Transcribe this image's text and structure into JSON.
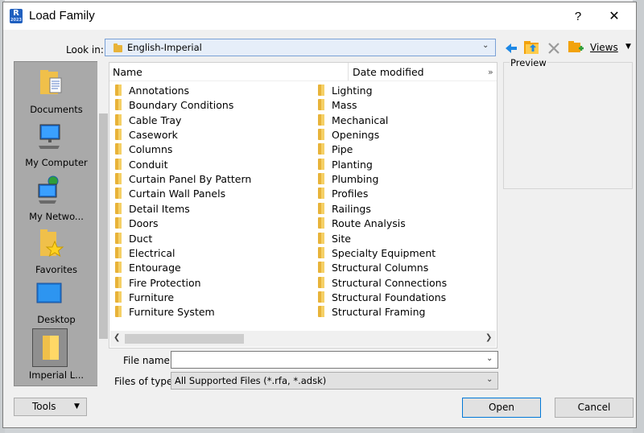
{
  "window": {
    "title": "Load Family",
    "app_icon": "R",
    "app_icon_sub": "2023",
    "help": "?",
    "close": "✕"
  },
  "lookin": {
    "label": "Look in:",
    "value": "English-Imperial"
  },
  "toolbar": {
    "views_label": "Views"
  },
  "places": [
    {
      "label": "Documents"
    },
    {
      "label": "My Computer"
    },
    {
      "label": "My Netwo..."
    },
    {
      "label": "Favorites"
    },
    {
      "label": "Desktop"
    },
    {
      "label": "Imperial L..."
    }
  ],
  "list": {
    "col_name": "Name",
    "col_date": "Date modified",
    "col_more": "»",
    "left_items": [
      "Annotations",
      "Boundary Conditions",
      "Cable Tray",
      "Casework",
      "Columns",
      "Conduit",
      "Curtain Panel By Pattern",
      "Curtain Wall Panels",
      "Detail Items",
      "Doors",
      "Duct",
      "Electrical",
      "Entourage",
      "Fire Protection",
      "Furniture",
      "Furniture System"
    ],
    "right_items": [
      "Lighting",
      "Mass",
      "Mechanical",
      "Openings",
      "Pipe",
      "Planting",
      "Plumbing",
      "Profiles",
      "Railings",
      "Route Analysis",
      "Site",
      "Specialty Equipment",
      "Structural Columns",
      "Structural Connections",
      "Structural Foundations",
      "Structural Framing"
    ]
  },
  "preview": {
    "label": "Preview"
  },
  "filename": {
    "label": "File name:",
    "value": ""
  },
  "filetype": {
    "label": "Files of type:",
    "value": "All Supported Files  (*.rfa, *.adsk)"
  },
  "buttons": {
    "tools": "Tools",
    "open": "Open",
    "cancel": "Cancel"
  },
  "colors": {
    "accent": "#0078d7",
    "folder": "#e8b339"
  }
}
